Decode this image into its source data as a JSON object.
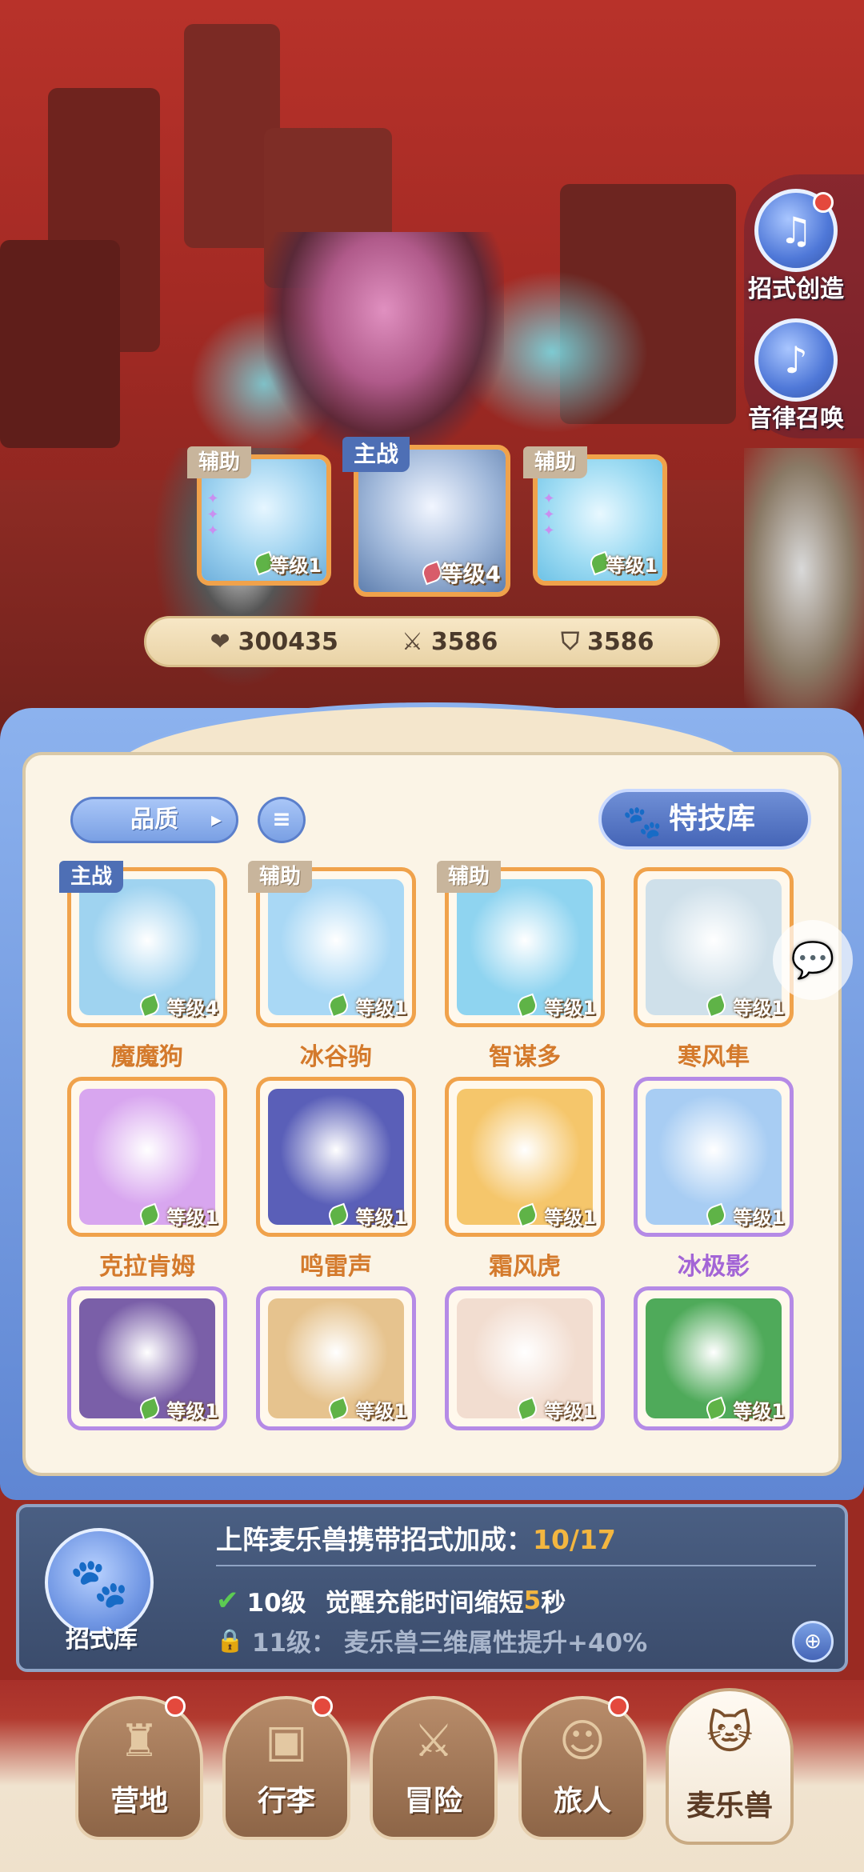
{
  "side_menu": [
    {
      "label": "招式创造",
      "icon": "book-music-icon",
      "badge": true
    },
    {
      "label": "音律召唤",
      "icon": "lyre-icon",
      "badge": false
    }
  ],
  "team": [
    {
      "role": "辅助",
      "level": "等级1"
    },
    {
      "role": "主战",
      "level": "等级4"
    },
    {
      "role": "辅助",
      "level": "等级1"
    }
  ],
  "stats": {
    "hp": "300435",
    "attack": "3586",
    "defense": "3586"
  },
  "filters": {
    "quality_label": "品质",
    "sort_icon": "list-sort-icon",
    "skill_library_label": "特技库"
  },
  "pets": [
    {
      "name": "魔魔狗",
      "level": "等级4",
      "role": "主战",
      "rarity": "orange",
      "color": "#9fd3f0"
    },
    {
      "name": "冰谷驹",
      "level": "等级1",
      "role": "辅助",
      "rarity": "orange",
      "color": "#a9d8f5"
    },
    {
      "name": "智谋多",
      "level": "等级1",
      "role": "辅助",
      "rarity": "orange",
      "color": "#8fd4f0"
    },
    {
      "name": "寒风隼",
      "level": "等级1",
      "role": "",
      "rarity": "orange",
      "color": "#cfe0ea"
    },
    {
      "name": "克拉肯姆",
      "level": "等级1",
      "role": "",
      "rarity": "orange",
      "color": "#d8a6ef"
    },
    {
      "name": "鸣雷声",
      "level": "等级1",
      "role": "",
      "rarity": "orange",
      "color": "#5a5fb8"
    },
    {
      "name": "霜风虎",
      "level": "等级1",
      "role": "",
      "rarity": "orange",
      "color": "#f5c66b"
    },
    {
      "name": "冰极影",
      "level": "等级1",
      "role": "",
      "rarity": "purple",
      "color": "#a8cdf3"
    },
    {
      "name": "",
      "level": "等级1",
      "role": "",
      "rarity": "purple",
      "color": "#7a5fa8"
    },
    {
      "name": "",
      "level": "等级1",
      "role": "",
      "rarity": "purple",
      "color": "#e6c38e"
    },
    {
      "name": "",
      "level": "等级1",
      "role": "",
      "rarity": "purple",
      "color": "#f2ddd0"
    },
    {
      "name": "",
      "level": "等级1",
      "role": "",
      "rarity": "purple",
      "color": "#4faa5a"
    }
  ],
  "bonus": {
    "title": "上阵麦乐兽携带招式加成：",
    "progress": "10/17",
    "icon_label": "招式库",
    "line1_level": "10级",
    "line1_text": "觉醒充能时间缩短",
    "line1_value": "5",
    "line1_unit": "秒",
    "line2_level": "11级：",
    "line2_text": "麦乐兽三维属性提升+40%"
  },
  "nav": [
    {
      "label": "营地",
      "icon": "castle-icon",
      "badge": true
    },
    {
      "label": "行李",
      "icon": "backpack-icon",
      "badge": true
    },
    {
      "label": "冒险",
      "icon": "crossed-swords-icon",
      "badge": false
    },
    {
      "label": "旅人",
      "icon": "traveler-icon",
      "badge": true
    },
    {
      "label": "麦乐兽",
      "icon": "cat-pet-icon",
      "badge": false,
      "active": true
    }
  ]
}
